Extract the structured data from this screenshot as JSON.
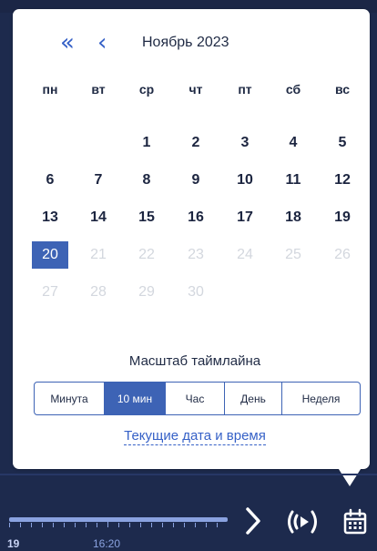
{
  "calendar": {
    "nav_fast": "«",
    "nav_prev": "‹",
    "month_title": "Ноябрь 2023",
    "weekdays": [
      "пн",
      "вт",
      "ср",
      "чт",
      "пт",
      "сб",
      "вс"
    ],
    "days": [
      {
        "label": "1",
        "state": "normal"
      },
      {
        "label": "2",
        "state": "normal"
      },
      {
        "label": "3",
        "state": "normal"
      },
      {
        "label": "4",
        "state": "normal"
      },
      {
        "label": "5",
        "state": "normal"
      },
      {
        "label": "6",
        "state": "normal"
      },
      {
        "label": "7",
        "state": "normal"
      },
      {
        "label": "8",
        "state": "normal"
      },
      {
        "label": "9",
        "state": "normal"
      },
      {
        "label": "10",
        "state": "normal"
      },
      {
        "label": "11",
        "state": "normal"
      },
      {
        "label": "12",
        "state": "normal"
      },
      {
        "label": "13",
        "state": "normal"
      },
      {
        "label": "14",
        "state": "normal"
      },
      {
        "label": "15",
        "state": "normal"
      },
      {
        "label": "16",
        "state": "normal"
      },
      {
        "label": "17",
        "state": "normal"
      },
      {
        "label": "18",
        "state": "normal"
      },
      {
        "label": "19",
        "state": "normal"
      },
      {
        "label": "20",
        "state": "selected"
      },
      {
        "label": "21",
        "state": "disabled"
      },
      {
        "label": "22",
        "state": "disabled"
      },
      {
        "label": "23",
        "state": "disabled"
      },
      {
        "label": "24",
        "state": "disabled"
      },
      {
        "label": "25",
        "state": "disabled"
      },
      {
        "label": "26",
        "state": "disabled"
      },
      {
        "label": "27",
        "state": "disabled"
      },
      {
        "label": "28",
        "state": "disabled"
      },
      {
        "label": "29",
        "state": "disabled"
      },
      {
        "label": "30",
        "state": "disabled"
      }
    ]
  },
  "scale": {
    "title": "Масштаб таймлайна",
    "options": [
      "Минута",
      "10 мин",
      "Час",
      "День",
      "Неделя"
    ],
    "active": "10 мин"
  },
  "current_link": "Текущие дата и время",
  "timeline": {
    "label_left": "19",
    "label_time": "16:20"
  },
  "icons": {
    "next": "chevron-right-icon",
    "live": "live-broadcast-icon",
    "calendar": "calendar-icon"
  },
  "colors": {
    "accent": "#3d63b5",
    "link": "#3661c7",
    "background": "#1d2a4d",
    "disabled": "#d3d7de"
  }
}
